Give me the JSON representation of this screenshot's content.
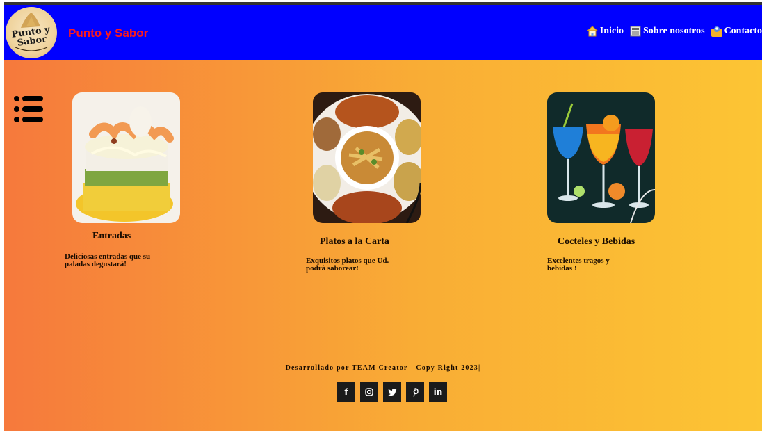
{
  "header": {
    "logo_text": "Punto y Sabor",
    "brand": "Punto y Sabor",
    "nav": [
      {
        "label": "Inicio",
        "icon": "house-icon"
      },
      {
        "label": "Sobre nosotros",
        "icon": "newspaper-icon"
      },
      {
        "label": "Contacto",
        "icon": "contact-card-icon"
      }
    ]
  },
  "cards": [
    {
      "title": "Entradas",
      "description": "Deliciosas entradas que su paladas degustarà!",
      "image": "causa-dish-photo"
    },
    {
      "title": "Platos a la Carta",
      "description": "Exquisitos platos que Ud. podrà saborear!",
      "image": "platter-dish-photo"
    },
    {
      "title": "Cocteles y Bebidas",
      "description": "Excelentes tragos y bebidas !",
      "image": "cocktails-photo"
    }
  ],
  "footer": {
    "text": "Desarrollado por TEAM Creator - Copy Right 2023|",
    "socials": [
      {
        "label": "f",
        "icon": "facebook-icon"
      },
      {
        "label": "◎",
        "icon": "instagram-icon"
      },
      {
        "label": "🐦",
        "icon": "twitter-icon"
      },
      {
        "label": "℗",
        "icon": "pinterest-icon"
      },
      {
        "label": "in",
        "icon": "linkedin-icon"
      }
    ]
  },
  "colors": {
    "header_bg": "#0000ff",
    "brand": "#ff1a1a",
    "gradient_start": "#f6793c",
    "gradient_end": "#fcc534"
  }
}
